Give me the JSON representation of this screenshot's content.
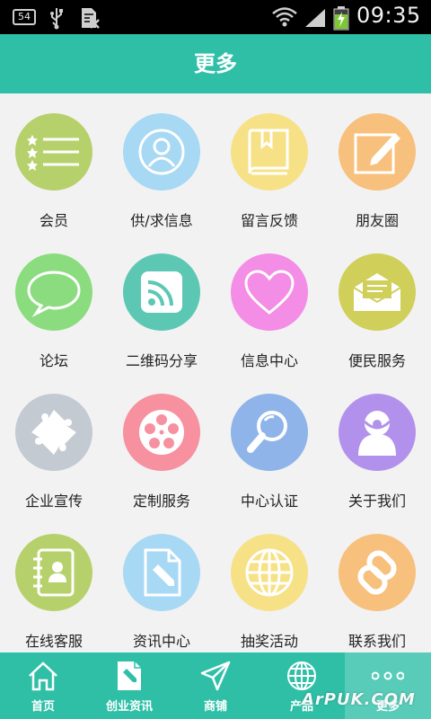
{
  "status_bar": {
    "badge": "54",
    "time": "09:35",
    "icons": [
      "usb-icon",
      "document-icon",
      "wifi-icon",
      "signal-icon",
      "battery-charging-icon"
    ]
  },
  "header": {
    "title": "更多"
  },
  "grid": {
    "items": [
      {
        "label": "会员",
        "icon": "member-list-icon",
        "color": "#b6d16b"
      },
      {
        "label": "供/求信息",
        "icon": "person-icon",
        "color": "#a7d8f4"
      },
      {
        "label": "留言反馈",
        "icon": "book-icon",
        "color": "#f7e186"
      },
      {
        "label": "朋友圈",
        "icon": "edit-icon",
        "color": "#f7c07c"
      },
      {
        "label": "论坛",
        "icon": "chat-bubble-icon",
        "color": "#8bdc7f"
      },
      {
        "label": "二维码分享",
        "icon": "rss-icon",
        "color": "#5cc8b4"
      },
      {
        "label": "信息中心",
        "icon": "heart-icon",
        "color": "#f38de6"
      },
      {
        "label": "便民服务",
        "icon": "mail-icon",
        "color": "#cfcf5a"
      },
      {
        "label": "企业宣传",
        "icon": "puzzle-icon",
        "color": "#c4cad2"
      },
      {
        "label": "定制服务",
        "icon": "film-reel-icon",
        "color": "#f7909f"
      },
      {
        "label": "中心认证",
        "icon": "magnifier-icon",
        "color": "#8eb4ea"
      },
      {
        "label": "关于我们",
        "icon": "user-icon",
        "color": "#b291ec"
      },
      {
        "label": "在线客服",
        "icon": "contacts-icon",
        "color": "#b6d16b"
      },
      {
        "label": "资讯中心",
        "icon": "document-edit-icon",
        "color": "#a7d8f4"
      },
      {
        "label": "抽奖活动",
        "icon": "globe-icon",
        "color": "#f7e186"
      },
      {
        "label": "联系我们",
        "icon": "link-icon",
        "color": "#f7c07c"
      }
    ]
  },
  "bottom_nav": {
    "items": [
      {
        "label": "首页",
        "icon": "home-icon"
      },
      {
        "label": "创业资讯",
        "icon": "document-edit-icon"
      },
      {
        "label": "商铺",
        "icon": "paper-plane-icon"
      },
      {
        "label": "产品",
        "icon": "globe-icon"
      },
      {
        "label": "更多",
        "icon": "more-dots-icon"
      }
    ],
    "active_index": 4
  },
  "watermark": "ArPUK.COM",
  "colors": {
    "accent": "#2fbfa7",
    "active_tab": "#58ccb9",
    "background": "#f2f2f2"
  }
}
